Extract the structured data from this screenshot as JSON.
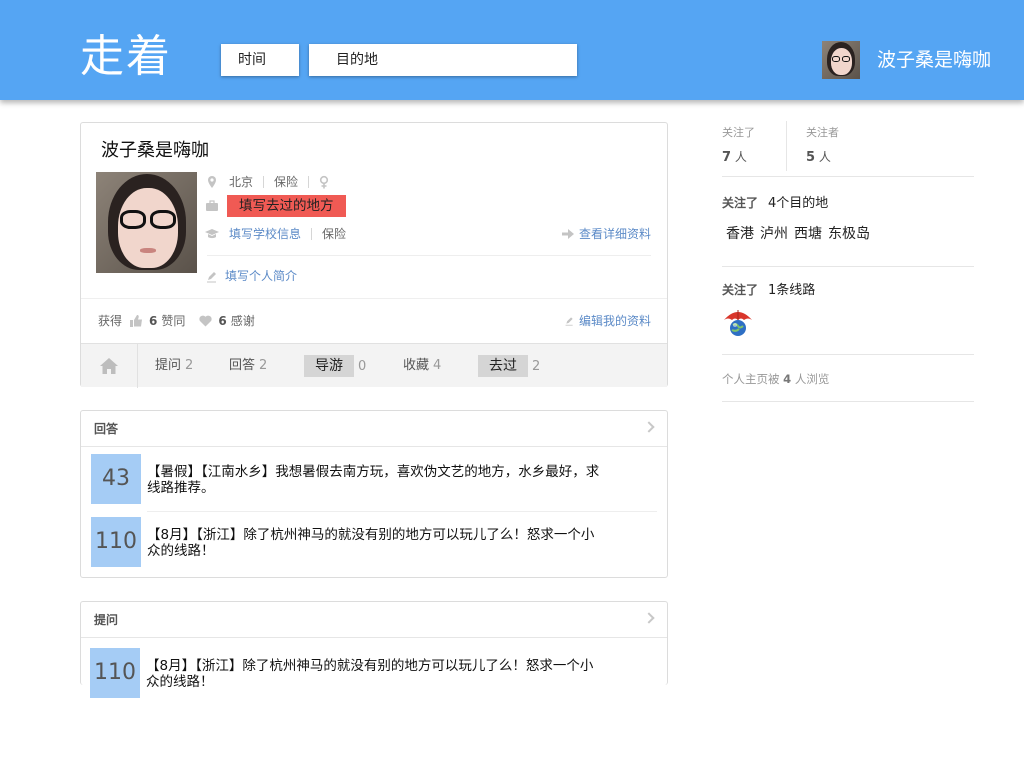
{
  "header": {
    "logo": "走着",
    "time_label": "时间",
    "destination_placeholder": "目的地",
    "user_name": "波子桑是嗨咖",
    "bg_color": "#55a5f3"
  },
  "profile": {
    "name": "波子桑是嗨咖",
    "city": "北京",
    "industry": "保险",
    "gender_icon": "female-icon",
    "places_badge": "填写去过的地方",
    "school_link": "填写学校信息",
    "school_industry": "保险",
    "detail_link": "查看详细资料",
    "bio_link": "填写个人简介",
    "stats_prefix": "获得",
    "likes_count": "6",
    "likes_label": "赞同",
    "thanks_count": "6",
    "thanks_label": "感谢",
    "edit_link": "编辑我的资料"
  },
  "tabs": [
    {
      "label": "提问",
      "count": "2"
    },
    {
      "label": "回答",
      "count": "2"
    },
    {
      "label": "导游",
      "count": "0"
    },
    {
      "label": "收藏",
      "count": "4"
    },
    {
      "label": "去过",
      "count": "2"
    }
  ],
  "answers": {
    "title": "回答",
    "items": [
      {
        "votes": "43",
        "text": "【暑假】【江南水乡】我想暑假去南方玩，喜欢伪文艺的地方，水乡最好，求线路推荐。"
      },
      {
        "votes": "110",
        "text": "【8月】【浙江】除了杭州神马的就没有别的地方可以玩儿了么！怒求一个小众的线路！"
      }
    ]
  },
  "questions": {
    "title": "提问",
    "items": [
      {
        "votes": "110",
        "text": "【8月】【浙江】除了杭州神马的就没有别的地方可以玩儿了么！怒求一个小众的线路！"
      }
    ]
  },
  "sidebar": {
    "following_label": "关注了",
    "following_count": "7",
    "followers_label": "关注者",
    "followers_count": "5",
    "people_unit": "人",
    "follow_dest_label": "关注了",
    "follow_dest_text": "4个目的地",
    "destinations": [
      "香港",
      "泸州",
      "西塘",
      "东极岛"
    ],
    "follow_route_label": "关注了",
    "follow_route_text": "1条线路",
    "route_icon": "umbrella-globe-icon",
    "views_prefix": "个人主页被",
    "views_count": "4",
    "views_suffix": "人浏览"
  },
  "colors": {
    "accent": "#55a5f3",
    "badge": "#f05a54",
    "vote_box": "#a5ccf5",
    "link": "#5b8ac7"
  }
}
